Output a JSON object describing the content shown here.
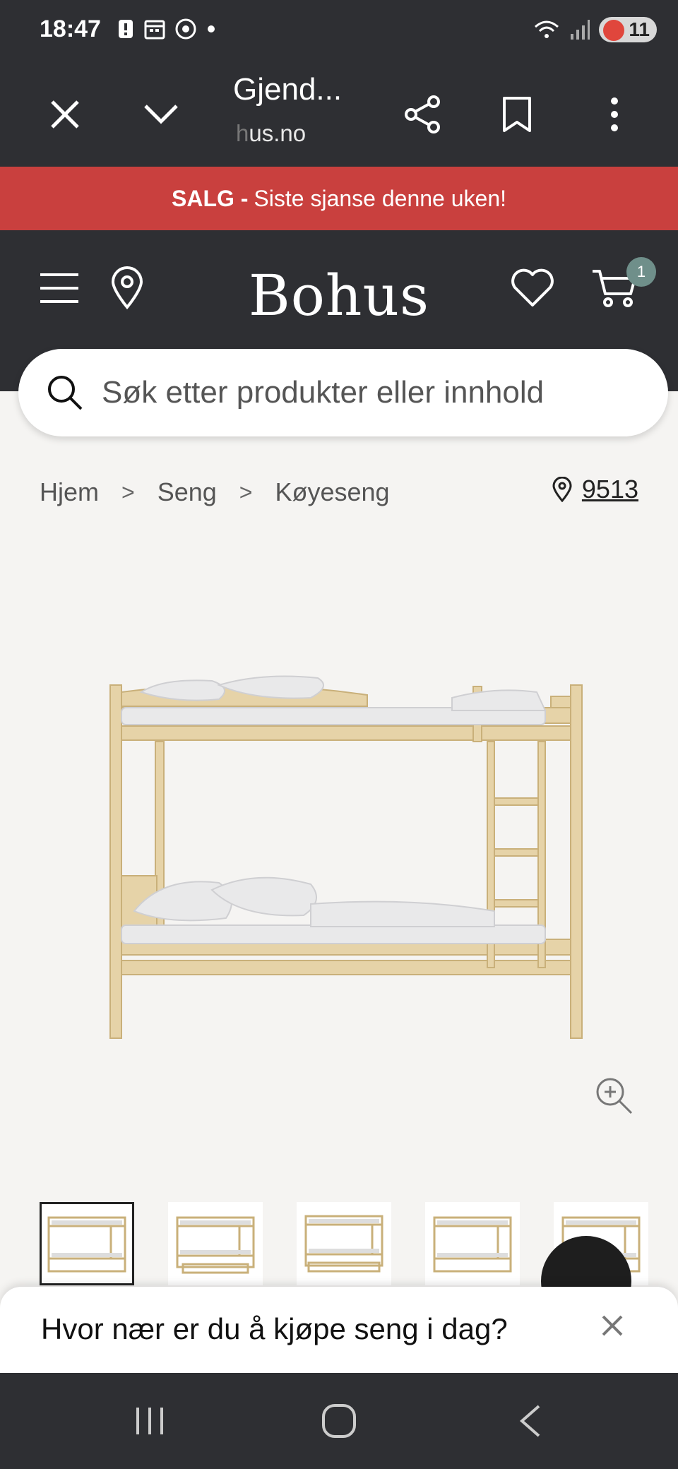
{
  "status_bar": {
    "time": "18:47",
    "battery": "11",
    "icons_left": [
      "alert-icon",
      "calendar-icon",
      "chrome-icon",
      "dot-icon"
    ],
    "icons_right": [
      "wifi-icon",
      "signal-icon",
      "battery-icon"
    ]
  },
  "browser": {
    "title": "Gjend...",
    "url_prefix": "h",
    "url_rest": "us.no",
    "icons": [
      "close-icon",
      "chevron-down-icon",
      "share-icon",
      "bookmark-icon",
      "more-vert-icon"
    ]
  },
  "promo": {
    "bold": "SALG -",
    "text": "Siste sjanse denne uken!",
    "color": "#c9403e"
  },
  "header": {
    "logo": "Bohus",
    "cart_count": "1",
    "icons": [
      "menu-icon",
      "location-pin-icon",
      "heart-icon",
      "cart-icon"
    ]
  },
  "search": {
    "placeholder": "Søk etter produkter eller innhold"
  },
  "breadcrumb": {
    "items": [
      "Hjem",
      "Seng",
      "Køyeseng"
    ],
    "separator": ">",
    "store_number": "9513"
  },
  "thumbnails_count": 5,
  "bottom_sheet": {
    "text": "Hvor nær er du å kjøpe seng i dag?"
  },
  "nav": {
    "icons": [
      "recent-apps-icon",
      "home-icon",
      "back-icon"
    ]
  }
}
